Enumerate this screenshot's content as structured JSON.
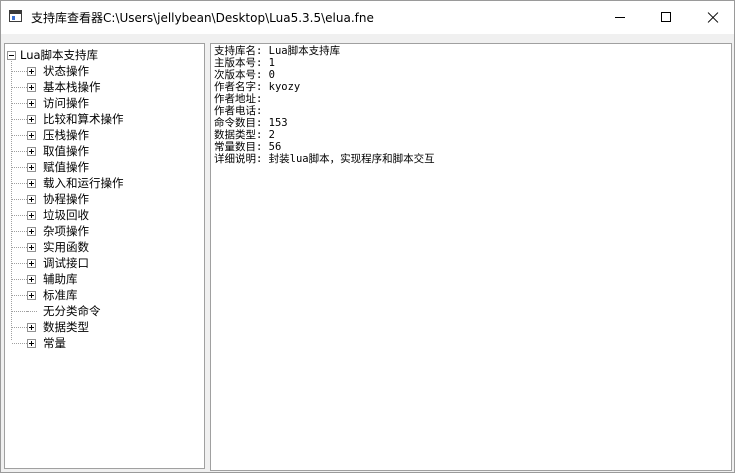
{
  "window": {
    "title": "支持库查看器C:\\Users\\jellybean\\Desktop\\Lua5.3.5\\elua.fne"
  },
  "tree": {
    "root_label": "Lua脚本支持库",
    "items": [
      {
        "label": "状态操作",
        "expandable": true
      },
      {
        "label": "基本栈操作",
        "expandable": true
      },
      {
        "label": "访问操作",
        "expandable": true
      },
      {
        "label": "比较和算术操作",
        "expandable": true
      },
      {
        "label": "压栈操作",
        "expandable": true
      },
      {
        "label": "取值操作",
        "expandable": true
      },
      {
        "label": "赋值操作",
        "expandable": true
      },
      {
        "label": "载入和运行操作",
        "expandable": true
      },
      {
        "label": "协程操作",
        "expandable": true
      },
      {
        "label": "垃圾回收",
        "expandable": true
      },
      {
        "label": "杂项操作",
        "expandable": true
      },
      {
        "label": "实用函数",
        "expandable": true
      },
      {
        "label": "调试接口",
        "expandable": true
      },
      {
        "label": "辅助库",
        "expandable": true
      },
      {
        "label": "标准库",
        "expandable": true
      },
      {
        "label": "无分类命令",
        "expandable": false
      },
      {
        "label": "数据类型",
        "expandable": true
      },
      {
        "label": "常量",
        "expandable": true
      }
    ]
  },
  "details": [
    "支持库名: Lua脚本支持库",
    "主版本号: 1",
    "次版本号: 0",
    "作者名字: kyozy",
    "作者地址:",
    "作者电话:",
    "命令数目: 153",
    "数据类型: 2",
    "常量数目: 56",
    "详细说明: 封装lua脚本，实现程序和脚本交互"
  ]
}
